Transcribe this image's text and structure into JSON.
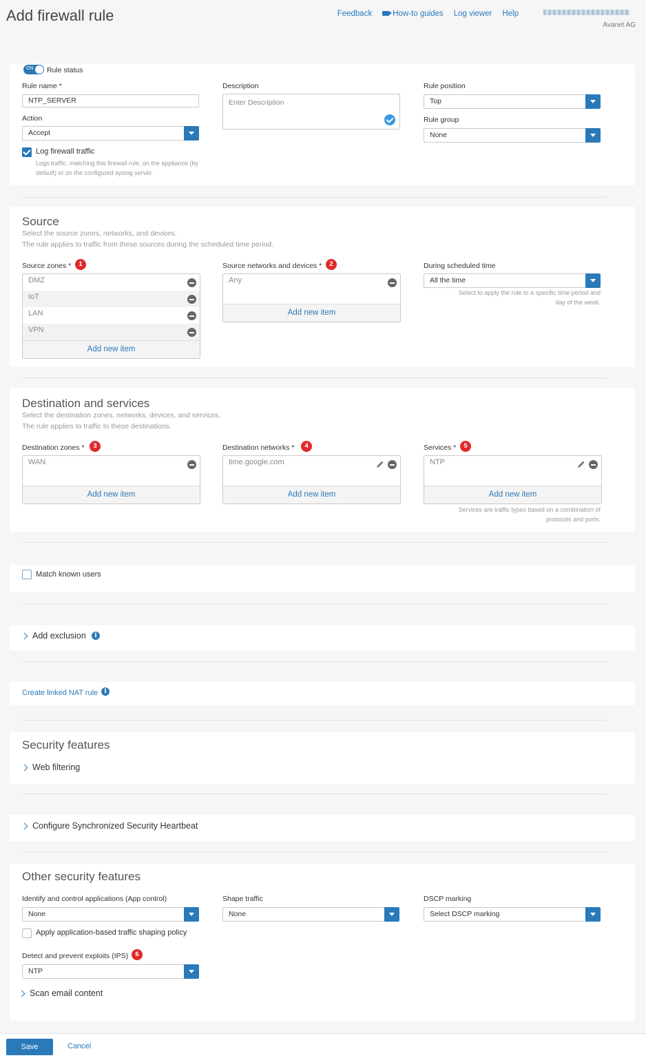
{
  "header": {
    "title": "Add firewall rule",
    "links": [
      "Feedback",
      "How-to guides",
      "Log viewer",
      "Help"
    ],
    "company": "Avanet AG"
  },
  "general": {
    "rule_status_toggle": "ON",
    "rule_status_label": "Rule status",
    "rule_name_label": "Rule name *",
    "rule_name_value": "NTP_SERVER",
    "action_label": "Action",
    "action_value": "Accept",
    "log_label": "Log firewall traffic",
    "log_checked": true,
    "log_help_1": "Logs traffic, matching this firewall rule, on the appliance (by",
    "log_help_2": "default) or on the configured syslog server.",
    "description_label": "Description",
    "description_placeholder": "Enter Description",
    "rule_position_label": "Rule position",
    "rule_position_value": "Top",
    "rule_group_label": "Rule group",
    "rule_group_value": "None"
  },
  "source": {
    "title": "Source",
    "sub1": "Select the source zones, networks, and devices.",
    "sub2": "The rule applies to traffic from these sources during the scheduled time period.",
    "zones_label": "Source zones *",
    "zones_badge": "1",
    "zones": [
      "DMZ",
      "IoT",
      "LAN",
      "VPN"
    ],
    "networks_label": "Source networks and devices *",
    "networks_badge": "2",
    "networks": [
      "Any"
    ],
    "schedule_label": "During scheduled time",
    "schedule_value": "All the time",
    "schedule_hint_1": "Select to apply the rule to a specific time period and",
    "schedule_hint_2": "day of the week.",
    "add_new": "Add new item"
  },
  "destination": {
    "title": "Destination and services",
    "sub1": "Select the destination zones, networks, devices, and services.",
    "sub2": "The rule applies to traffic to these destinations.",
    "zones_label": "Destination zones *",
    "zones_badge": "3",
    "zones": [
      "WAN"
    ],
    "networks_label": "Destination networks *",
    "networks_badge": "4",
    "networks": [
      "time.google.com"
    ],
    "services_label": "Services *",
    "services_badge": "5",
    "services": [
      "NTP"
    ],
    "services_hint_1": "Services are traffic types based on a combination of",
    "services_hint_2": "protocols and ports.",
    "add_new": "Add new item"
  },
  "users": {
    "match_known_users": "Match known users"
  },
  "exclusion": {
    "label": "Add exclusion"
  },
  "nat": {
    "label": "Create linked NAT rule"
  },
  "security": {
    "title": "Security features",
    "web_filtering": "Web filtering",
    "heartbeat": "Configure Synchronized Security Heartbeat"
  },
  "other": {
    "title": "Other security features",
    "app_control_label": "Identify and control applications (App control)",
    "app_control_value": "None",
    "shape_label": "Shape traffic",
    "shape_value": "None",
    "dscp_label": "DSCP marking",
    "dscp_value": "Select DSCP marking",
    "app_shaping_label": "Apply application-based traffic shaping policy",
    "ips_label": "Detect and prevent exploits (IPS)",
    "ips_badge": "6",
    "ips_value": "NTP",
    "scan_email": "Scan email content"
  },
  "footer": {
    "save": "Save",
    "cancel": "Cancel"
  }
}
